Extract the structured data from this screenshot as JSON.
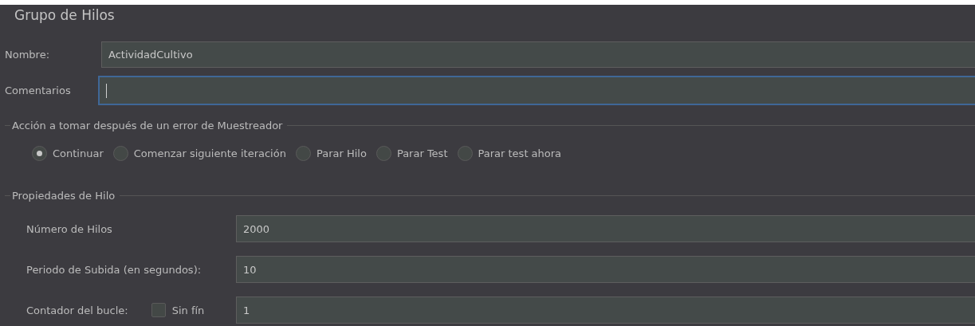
{
  "title": "Grupo de Hilos",
  "name_field": {
    "label": "Nombre:",
    "value": "ActividadCultivo"
  },
  "comments_field": {
    "label": "Comentarios",
    "focused": true
  },
  "error_action": {
    "legend": "Acción a tomar después de un error de Muestreador",
    "options": [
      {
        "label": "Continuar",
        "selected": true
      },
      {
        "label": "Comenzar siguiente iteración",
        "selected": false
      },
      {
        "label": "Parar Hilo",
        "selected": false
      },
      {
        "label": "Parar Test",
        "selected": false
      },
      {
        "label": "Parar test ahora",
        "selected": false
      }
    ]
  },
  "thread_properties": {
    "legend": "Propiedades de Hilo",
    "fields": [
      {
        "kind": "text",
        "label": "Número de Hilos",
        "value": "2000"
      },
      {
        "kind": "text",
        "label": "Periodo de Subida (en segundos):",
        "value": "10"
      },
      {
        "kind": "loop",
        "label": "Contador del bucle:",
        "checkbox": {
          "label": "Sin fín",
          "checked": false
        },
        "value": "1"
      }
    ]
  }
}
